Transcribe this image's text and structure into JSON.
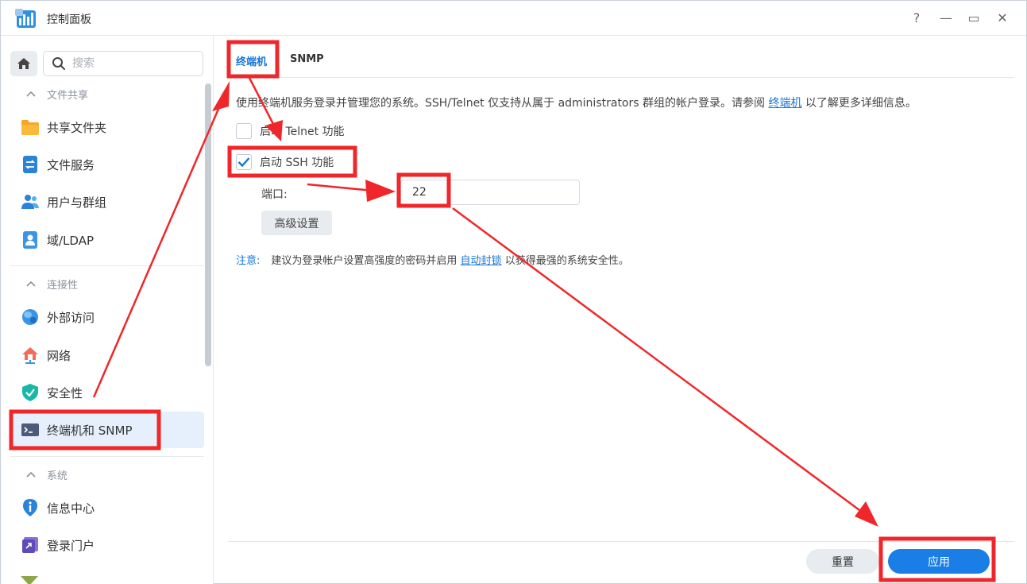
{
  "window": {
    "title": "控制面板",
    "help_glyph": "?",
    "minimize_glyph": "—",
    "maximize_glyph": "▭",
    "close_glyph": "✕"
  },
  "sidebar": {
    "search_placeholder": "搜索",
    "sections": [
      {
        "header": "文件共享",
        "items": [
          {
            "label": "共享文件夹",
            "icon": "folder-icon"
          },
          {
            "label": "文件服务",
            "icon": "file-services-icon"
          },
          {
            "label": "用户与群组",
            "icon": "users-icon"
          },
          {
            "label": "域/LDAP",
            "icon": "domain-icon"
          }
        ]
      },
      {
        "header": "连接性",
        "items": [
          {
            "label": "外部访问",
            "icon": "external-access-icon"
          },
          {
            "label": "网络",
            "icon": "network-icon"
          },
          {
            "label": "安全性",
            "icon": "security-icon"
          },
          {
            "label": "终端机和 SNMP",
            "icon": "terminal-icon",
            "active": true
          }
        ]
      },
      {
        "header": "系统",
        "items": [
          {
            "label": "信息中心",
            "icon": "info-icon"
          },
          {
            "label": "登录门户",
            "icon": "login-portal-icon"
          }
        ]
      }
    ]
  },
  "main": {
    "tabs": [
      {
        "label": "终端机",
        "active": true
      },
      {
        "label": "SNMP",
        "active": false
      }
    ],
    "description_prefix": "使用终端机服务登录并管理您的系统。SSH/Telnet 仅支持从属于 administrators 群组的帐户登录。请参阅",
    "description_link": "终端机",
    "description_suffix": "以了解更多详细信息。",
    "telnet_label": "启动 Telnet 功能",
    "telnet_checked": false,
    "ssh_label": "启动 SSH 功能",
    "ssh_checked": true,
    "port_label": "端口:",
    "port_value": "22",
    "advanced_button": "高级设置",
    "note_label": "注意:",
    "note_prefix": "建议为登录帐户设置高强度的密码并启用",
    "note_link": "自动封锁",
    "note_suffix": "以获得最强的系统安全性。",
    "reset_button": "重置",
    "apply_button": "应用"
  },
  "colors": {
    "accent": "#1576d6",
    "apply_button": "#1a7ee6",
    "annotation_red": "#f0272a",
    "active_nav_bg": "#e6f0fc"
  }
}
